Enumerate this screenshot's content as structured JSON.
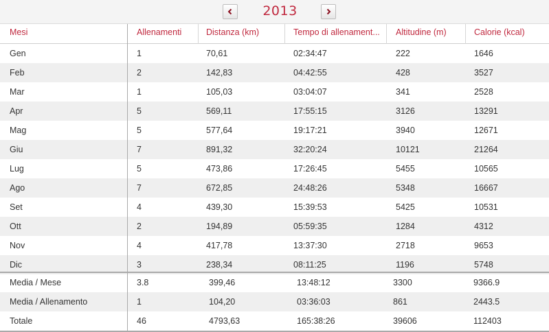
{
  "year_nav": {
    "year": "2013",
    "prev_icon": "chevron-left-icon",
    "next_icon": "chevron-right-icon"
  },
  "colors": {
    "accent": "#c0283e",
    "row_alt": "#efefef",
    "border": "#a9a9a9"
  },
  "table": {
    "headers": [
      "Mesi",
      "Allenamenti",
      "Distanza (km)",
      "Tempo di allenament...",
      "Altitudine (m)",
      "Calorie (kcal)"
    ],
    "rows": [
      [
        "Gen",
        "1",
        "70,61",
        "02:34:47",
        "222",
        "1646"
      ],
      [
        "Feb",
        "2",
        "142,83",
        "04:42:55",
        "428",
        "3527"
      ],
      [
        "Mar",
        "1",
        "105,03",
        "03:04:07",
        "341",
        "2528"
      ],
      [
        "Apr",
        "5",
        "569,11",
        "17:55:15",
        "3126",
        "13291"
      ],
      [
        "Mag",
        "5",
        "577,64",
        "19:17:21",
        "3940",
        "12671"
      ],
      [
        "Giu",
        "7",
        "891,32",
        "32:20:24",
        "10121",
        "21264"
      ],
      [
        "Lug",
        "5",
        "473,86",
        "17:26:45",
        "5455",
        "10565"
      ],
      [
        "Ago",
        "7",
        "672,85",
        "24:48:26",
        "5348",
        "16667"
      ],
      [
        "Set",
        "4",
        "439,30",
        "15:39:53",
        "5425",
        "10531"
      ],
      [
        "Ott",
        "2",
        "194,89",
        "05:59:35",
        "1284",
        "4312"
      ],
      [
        "Nov",
        "4",
        "417,78",
        "13:37:30",
        "2718",
        "9653"
      ],
      [
        "Dic",
        "3",
        "238,34",
        "08:11:25",
        "1196",
        "5748"
      ]
    ],
    "summary": [
      [
        "Media / Mese",
        "3.8",
        "399,46",
        "13:48:12",
        "3300",
        "9366.9"
      ],
      [
        "Media / Allenamento",
        "1",
        "104,20",
        "03:36:03",
        "861",
        "2443.5"
      ],
      [
        "Totale",
        "46",
        "4793,63",
        "165:38:26",
        "39606",
        "112403"
      ]
    ]
  }
}
